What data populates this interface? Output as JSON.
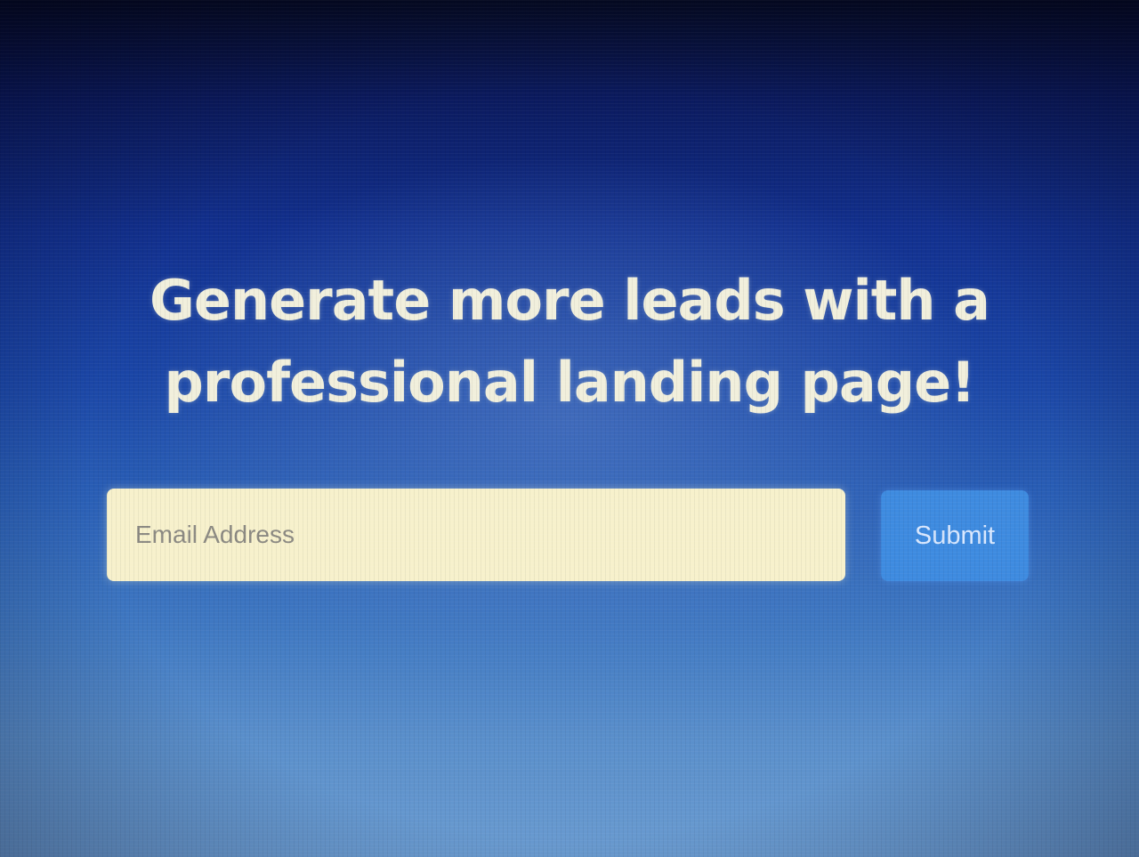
{
  "hero": {
    "headline_line1": "Generate more leads with a",
    "headline_line2": "professional landing page!"
  },
  "form": {
    "email_placeholder": "Email Address",
    "email_value": "",
    "submit_label": "Submit"
  },
  "colors": {
    "headline": "#f1efdc",
    "input_background": "#f7f1cc",
    "button_background": "#3e8be0",
    "button_text": "#d9e8ff",
    "background_top": "#050a22",
    "background_bottom": "#6a9bd0"
  }
}
